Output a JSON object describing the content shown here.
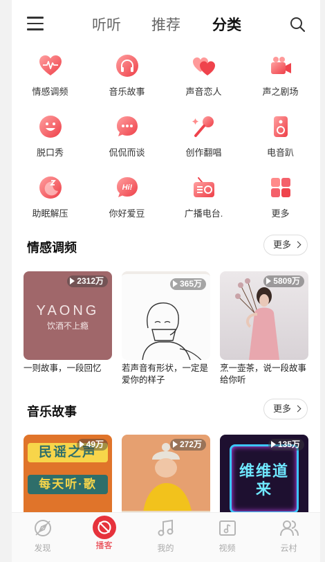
{
  "header": {
    "tabs": [
      {
        "label": "听听"
      },
      {
        "label": "推荐"
      },
      {
        "label": "分类",
        "active": true
      }
    ]
  },
  "categories": [
    {
      "label": "情感调频",
      "icon": "heart-pulse-icon"
    },
    {
      "label": "音乐故事",
      "icon": "headphones-icon"
    },
    {
      "label": "声音恋人",
      "icon": "two-hearts-icon"
    },
    {
      "label": "声之剧场",
      "icon": "video-camera-icon"
    },
    {
      "label": "脱口秀",
      "icon": "smiley-icon"
    },
    {
      "label": "侃侃而谈",
      "icon": "chat-bubble-icon"
    },
    {
      "label": "创作翻唱",
      "icon": "microphone-icon"
    },
    {
      "label": "电音趴",
      "icon": "speaker-icon"
    },
    {
      "label": "助眠解压",
      "icon": "moon-sleep-icon"
    },
    {
      "label": "你好爱豆",
      "icon": "hi-bubble-icon"
    },
    {
      "label": "广播电台.",
      "icon": "radio-icon"
    },
    {
      "label": "更多",
      "icon": "grid-more-icon"
    }
  ],
  "sections": [
    {
      "title": "情感调频",
      "more_label": "更多",
      "cards": [
        {
          "plays": "2312万",
          "caption": "一则故事，一段回忆",
          "cover_text": "YAONG",
          "cover_sub": "饮酒不上瘾"
        },
        {
          "plays": "365万",
          "caption": "若声音有形状，一定是爱你的样子"
        },
        {
          "plays": "5809万",
          "caption": "烹一壶茶，说一段故事给你听"
        }
      ]
    },
    {
      "title": "音乐故事",
      "more_label": "更多",
      "cards": [
        {
          "plays": "49万",
          "cover_text": "民谣之声",
          "cover_sub": "每天听·歌"
        },
        {
          "plays": "272万"
        },
        {
          "plays": "135万",
          "cover_text": "维维道来"
        }
      ]
    }
  ],
  "bottom_nav": [
    {
      "label": "发现",
      "icon": "discover-icon"
    },
    {
      "label": "播客",
      "icon": "podcast-icon",
      "active": true
    },
    {
      "label": "我的",
      "icon": "music-note-icon"
    },
    {
      "label": "视频",
      "icon": "video-icon"
    },
    {
      "label": "云村",
      "icon": "people-icon"
    }
  ],
  "colors": {
    "accent": "#e6323c",
    "icon_gradient_start": "#ff8a8a",
    "icon_gradient_end": "#f0484f"
  }
}
